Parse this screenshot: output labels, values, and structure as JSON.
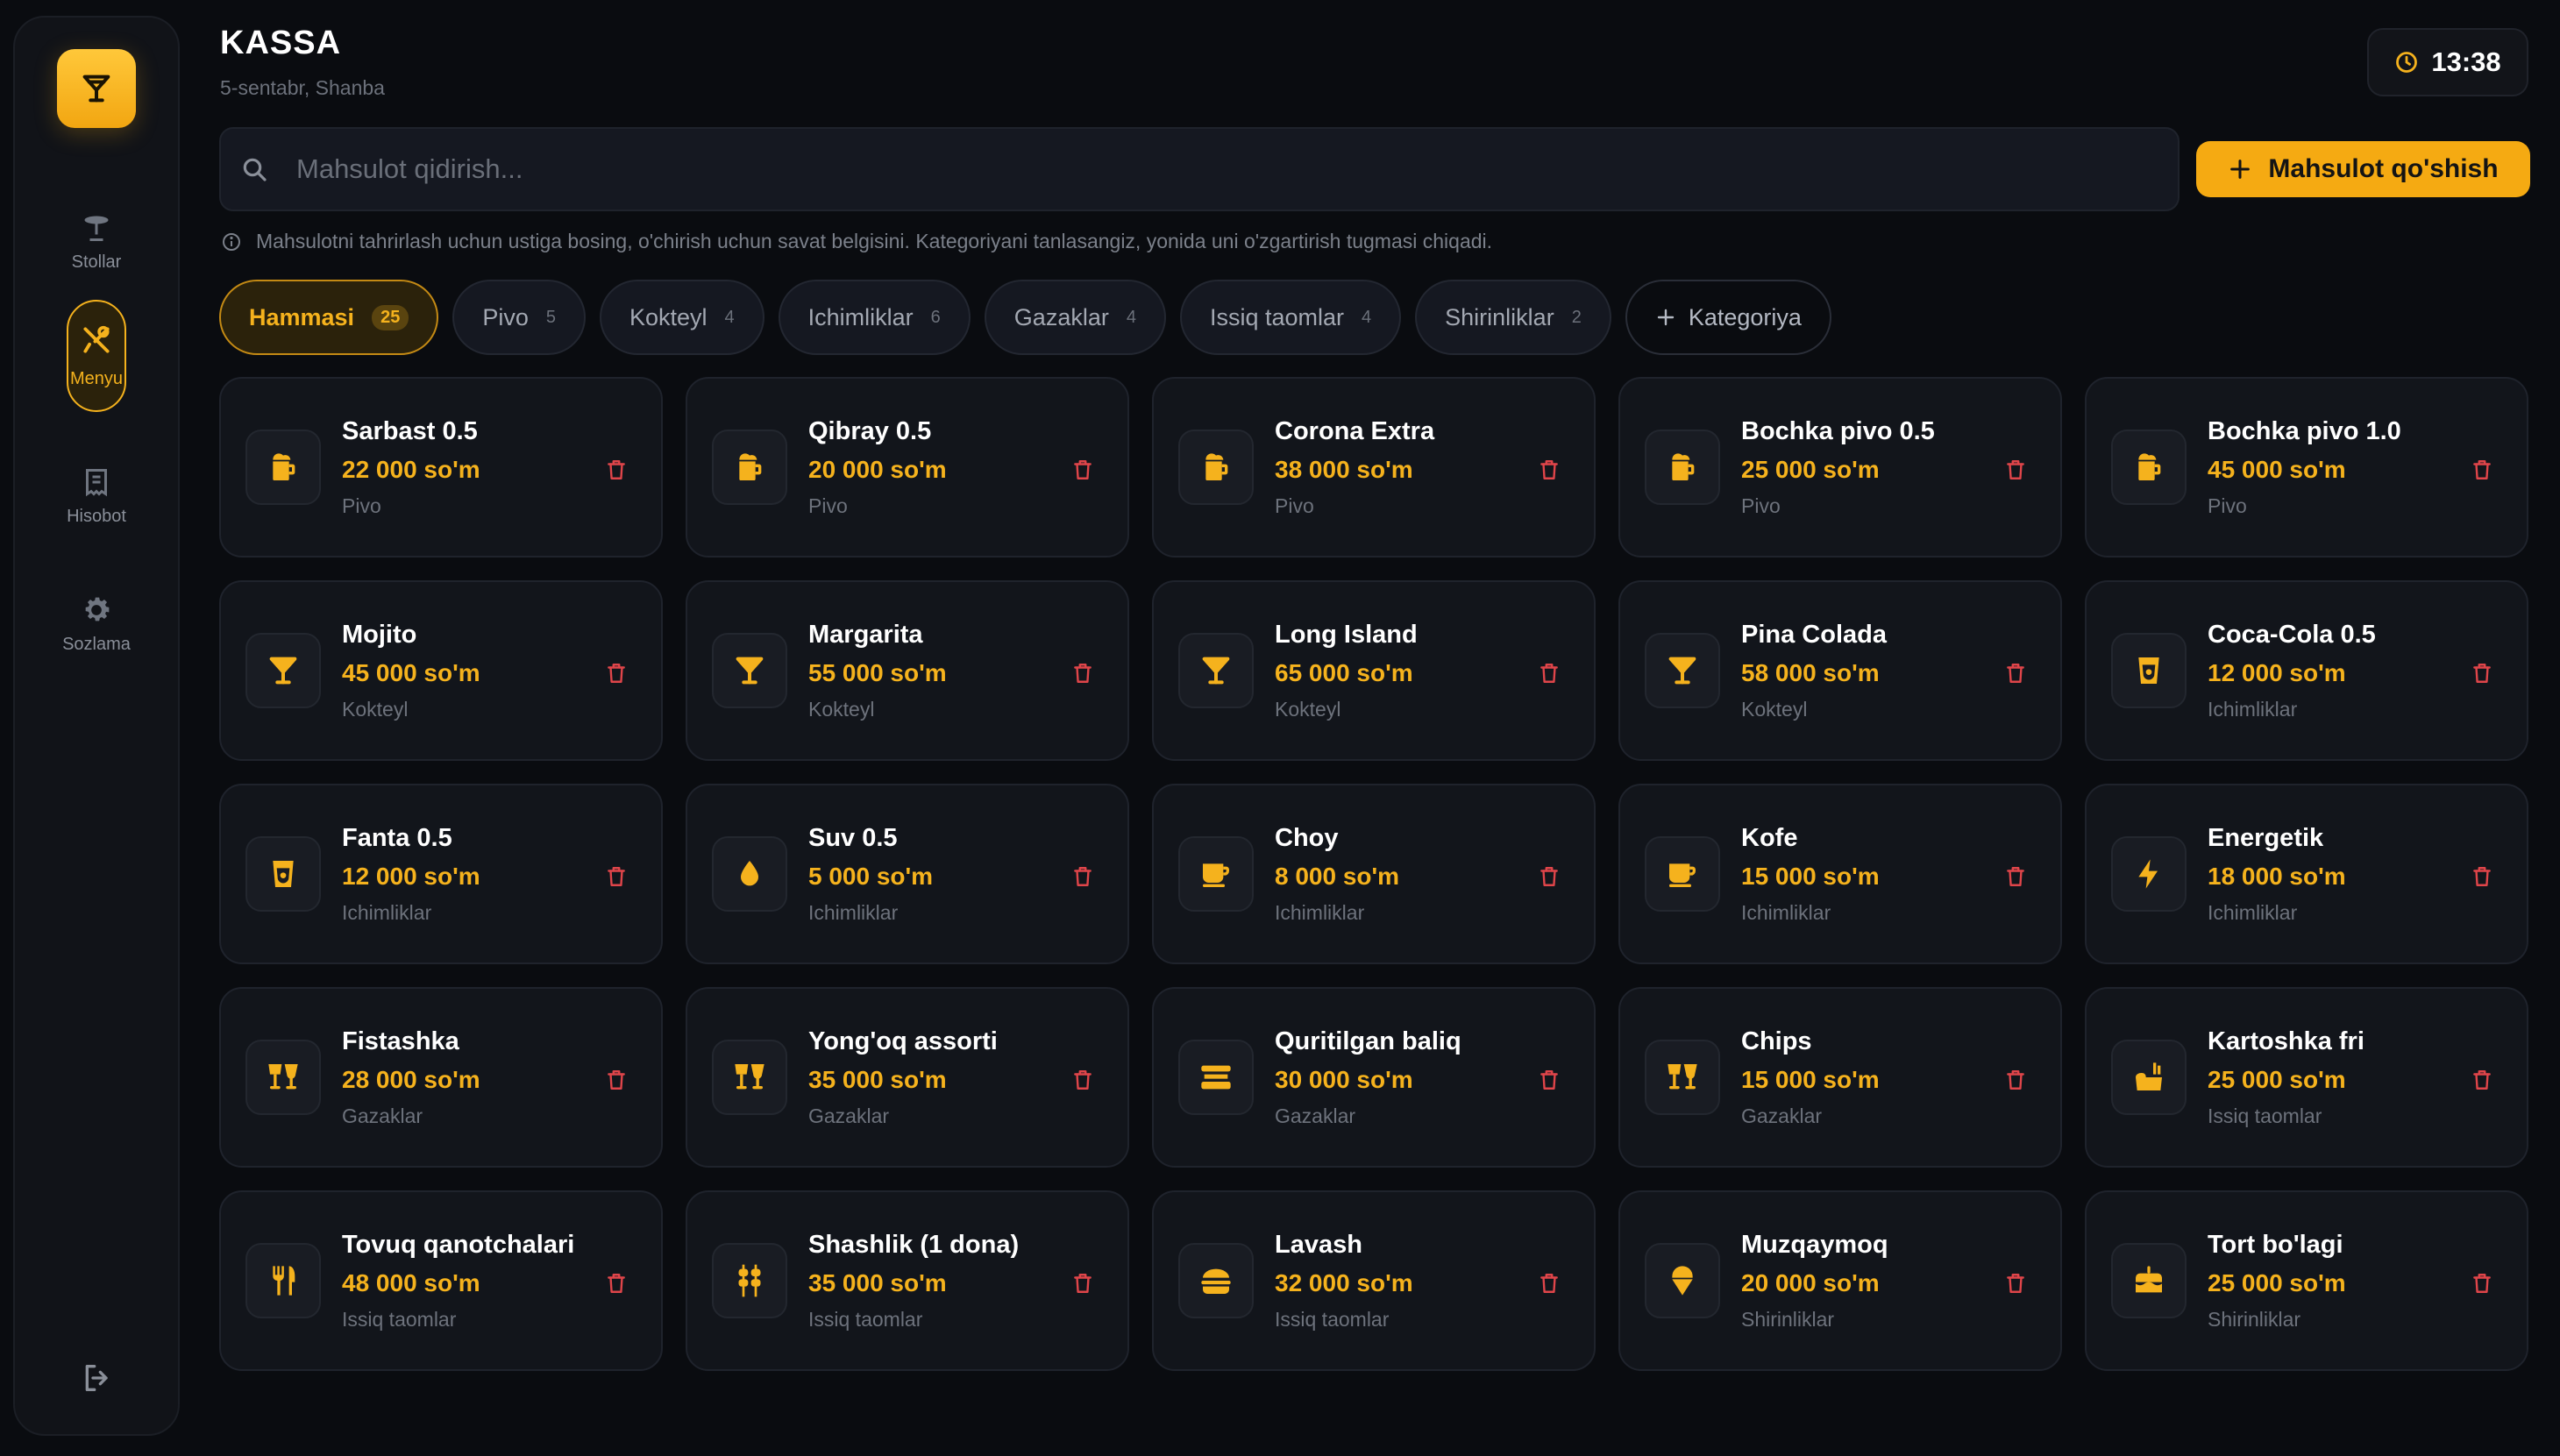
{
  "sidebar": {
    "items": [
      {
        "label": "Stollar",
        "icon": "table-icon"
      },
      {
        "label": "Menyu",
        "icon": "utensils-icon",
        "active": true
      },
      {
        "label": "Hisobot",
        "icon": "receipt-icon"
      },
      {
        "label": "Sozlama",
        "icon": "gear-icon"
      }
    ]
  },
  "header": {
    "title": "KASSA",
    "date": "5-sentabr, Shanba",
    "time": "13:38"
  },
  "search": {
    "placeholder": "Mahsulot qidirish..."
  },
  "add_product_label": "Mahsulot qo'shish",
  "hint": "Mahsulotni tahrirlash uchun ustiga bosing, o'chirish uchun savat belgisini. Kategoriyani tanlasangiz, yonida uni o'zgartirish tugmasi chiqadi.",
  "categories": [
    {
      "label": "Hammasi",
      "count": "25",
      "active": true
    },
    {
      "label": "Pivo",
      "count": "5"
    },
    {
      "label": "Kokteyl",
      "count": "4"
    },
    {
      "label": "Ichimliklar",
      "count": "6"
    },
    {
      "label": "Gazaklar",
      "count": "4"
    },
    {
      "label": "Issiq taomlar",
      "count": "4"
    },
    {
      "label": "Shirinliklar",
      "count": "2"
    }
  ],
  "add_category_label": "Kategoriya",
  "products": [
    {
      "name": "Sarbast 0.5",
      "price": "22 000 so'm",
      "category": "Pivo",
      "icon": "beer-icon"
    },
    {
      "name": "Qibray 0.5",
      "price": "20 000 so'm",
      "category": "Pivo",
      "icon": "beer-icon"
    },
    {
      "name": "Corona Extra",
      "price": "38 000 so'm",
      "category": "Pivo",
      "icon": "beer-icon"
    },
    {
      "name": "Bochka pivo 0.5",
      "price": "25 000 so'm",
      "category": "Pivo",
      "icon": "beer-icon"
    },
    {
      "name": "Bochka pivo 1.0",
      "price": "45 000 so'm",
      "category": "Pivo",
      "icon": "beer-icon"
    },
    {
      "name": "Mojito",
      "price": "45 000 so'm",
      "category": "Kokteyl",
      "icon": "cocktail-icon"
    },
    {
      "name": "Margarita",
      "price": "55 000 so'm",
      "category": "Kokteyl",
      "icon": "cocktail-icon"
    },
    {
      "name": "Long Island",
      "price": "65 000 so'm",
      "category": "Kokteyl",
      "icon": "cocktail-icon"
    },
    {
      "name": "Pina Colada",
      "price": "58 000 so'm",
      "category": "Kokteyl",
      "icon": "cocktail-icon"
    },
    {
      "name": "Coca-Cola 0.5",
      "price": "12 000 so'm",
      "category": "Ichimliklar",
      "icon": "soda-icon"
    },
    {
      "name": "Fanta 0.5",
      "price": "12 000 so'm",
      "category": "Ichimliklar",
      "icon": "soda-icon"
    },
    {
      "name": "Suv 0.5",
      "price": "5 000 so'm",
      "category": "Ichimliklar",
      "icon": "water-drop-icon"
    },
    {
      "name": "Choy",
      "price": "8 000 so'm",
      "category": "Ichimliklar",
      "icon": "mug-icon"
    },
    {
      "name": "Kofe",
      "price": "15 000 so'm",
      "category": "Ichimliklar",
      "icon": "mug-icon"
    },
    {
      "name": "Energetik",
      "price": "18 000 so'm",
      "category": "Ichimliklar",
      "icon": "bolt-icon"
    },
    {
      "name": "Fistashka",
      "price": "28 000 so'm",
      "category": "Gazaklar",
      "icon": "snack-icon"
    },
    {
      "name": "Yong'oq assorti",
      "price": "35 000 so'm",
      "category": "Gazaklar",
      "icon": "snack-icon"
    },
    {
      "name": "Quritilgan baliq",
      "price": "30 000 so'm",
      "category": "Gazaklar",
      "icon": "fish-plate-icon"
    },
    {
      "name": "Chips",
      "price": "15 000 so'm",
      "category": "Gazaklar",
      "icon": "snack-icon"
    },
    {
      "name": "Kartoshka fri",
      "price": "25 000 so'm",
      "category": "Issiq taomlar",
      "icon": "fries-icon"
    },
    {
      "name": "Tovuq qanotchalari",
      "price": "48 000 so'm",
      "category": "Issiq taomlar",
      "icon": "utensils-icon"
    },
    {
      "name": "Shashlik (1 dona)",
      "price": "35 000 so'm",
      "category": "Issiq taomlar",
      "icon": "skewer-icon"
    },
    {
      "name": "Lavash",
      "price": "32 000 so'm",
      "category": "Issiq taomlar",
      "icon": "burger-icon"
    },
    {
      "name": "Muzqaymoq",
      "price": "20 000 so'm",
      "category": "Shirinliklar",
      "icon": "ice-cream-icon"
    },
    {
      "name": "Tort bo'lagi",
      "price": "25 000 so'm",
      "category": "Shirinliklar",
      "icon": "cake-icon"
    }
  ],
  "colors": {
    "accent": "#f5aa12",
    "delete": "#e0454a",
    "background": "#0a0c10"
  }
}
